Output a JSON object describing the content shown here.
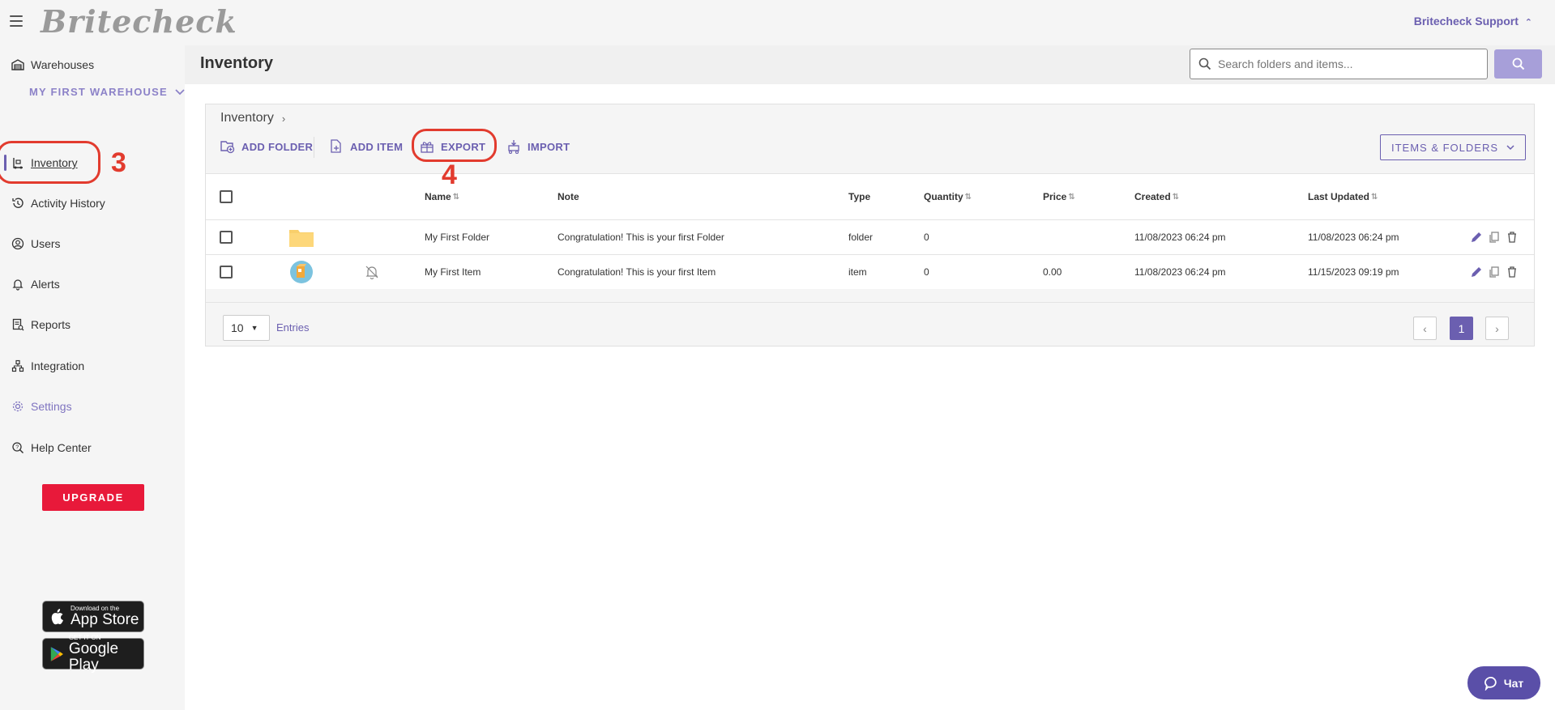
{
  "app": {
    "logo": "Britecheck",
    "support_label": "Britecheck Support",
    "support_chevron": "^"
  },
  "sidebar": {
    "warehouses_label": "Warehouses",
    "warehouse_selected": "MY FIRST WAREHOUSE",
    "items": [
      {
        "label": "Inventory",
        "icon": "inventory-icon"
      },
      {
        "label": "Activity History",
        "icon": "history-icon"
      },
      {
        "label": "Users",
        "icon": "users-icon"
      },
      {
        "label": "Alerts",
        "icon": "bell-icon"
      },
      {
        "label": "Reports",
        "icon": "reports-icon"
      },
      {
        "label": "Integration",
        "icon": "integration-icon"
      },
      {
        "label": "Settings",
        "icon": "gear-icon"
      },
      {
        "label": "Help Center",
        "icon": "help-icon"
      }
    ],
    "upgrade_label": "UPGRADE",
    "appstore": {
      "small": "Download on the",
      "big": "App Store"
    },
    "googleplay": {
      "small": "GET IT ON",
      "big": "Google Play"
    }
  },
  "annotations": {
    "first": "3",
    "second": "4"
  },
  "header": {
    "title": "Inventory",
    "search_placeholder": "Search folders and items..."
  },
  "toolbar": {
    "breadcrumb": "Inventory",
    "breadcrumb_sep": "›",
    "add_folder": "ADD FOLDER",
    "add_item": "ADD ITEM",
    "export": "EXPORT",
    "import": "IMPORT",
    "view_select": "ITEMS & FOLDERS"
  },
  "table": {
    "columns": {
      "name": "Name",
      "note": "Note",
      "type": "Type",
      "quantity": "Quantity",
      "price": "Price",
      "created": "Created",
      "updated": "Last Updated"
    },
    "rows": [
      {
        "name": "My First Folder",
        "note": "Congratulation! This is your first Folder",
        "type": "folder",
        "quantity": "0",
        "price": "",
        "created": "11/08/2023 06:24 pm",
        "updated": "11/08/2023 06:24 pm"
      },
      {
        "name": "My First Item",
        "note": "Congratulation! This is your first Item",
        "type": "item",
        "quantity": "0",
        "price": "0.00",
        "created": "11/08/2023 06:24 pm",
        "updated": "11/15/2023 09:19 pm"
      }
    ]
  },
  "footer": {
    "entries_value": "10",
    "entries_label": "Entries",
    "prev": "‹",
    "page": "1",
    "next": "›"
  },
  "chat": {
    "label": "Чат"
  },
  "colors": {
    "accent": "#6b5fb0",
    "upgrade": "#e8193a",
    "annotation": "#e23b2e"
  }
}
